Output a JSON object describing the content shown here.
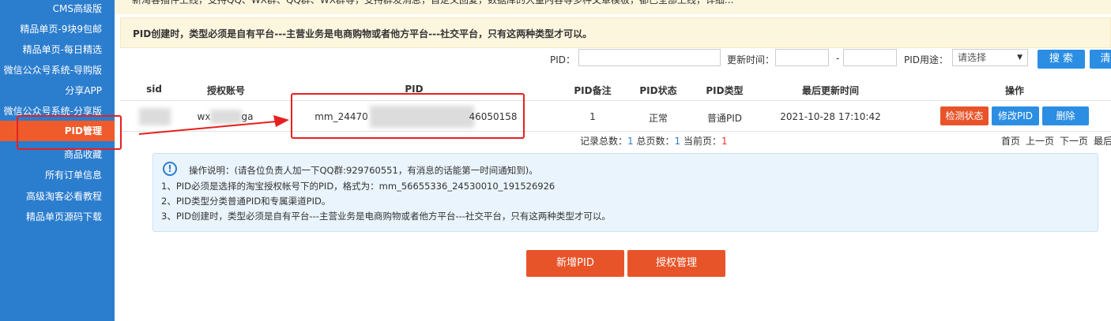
{
  "sidebar": {
    "items": [
      {
        "label": "CMS高级版"
      },
      {
        "label": "精品单页-9块9包邮"
      },
      {
        "label": "精品单页-每日精选"
      },
      {
        "label": "微信公众号系统-导购版"
      },
      {
        "label": "分享APP"
      },
      {
        "label": "微信公众号系统-分享版"
      },
      {
        "label": "PID管理"
      },
      {
        "label": "商品收藏"
      },
      {
        "label": "所有订单信息"
      },
      {
        "label": "高级淘客必看教程"
      },
      {
        "label": "精品单页源码下载"
      }
    ]
  },
  "notice_top": "新淘客插件上线，支持QQ、WX群、QQ群、WX群等，支持群发消息，自定义回复，数据库的大量内容等多种文章模板，都已全部上线，详细...",
  "notice": "PID创建时，类型必须是自有平台---主营业务是电商购物或者他方平台---社交平台，只有这两种类型才可以。",
  "search": {
    "pid_label": "PID：",
    "time_label": "更新时间：",
    "dash": "-",
    "use_label": "PID用途：",
    "use_value": "请选择",
    "search_btn": "搜 索",
    "clear_btn": "清"
  },
  "table": {
    "headers": [
      "sid",
      "授权账号",
      "PID",
      "PID备注",
      "PID状态",
      "PID类型",
      "最后更新时间",
      "操作"
    ],
    "row": {
      "account_prefix": "wx",
      "account_suffix": "ga",
      "pid_prefix": "mm_24470",
      "pid_suffix": "46050158",
      "note": "1",
      "status": "正常",
      "type": "普通PID",
      "updated": "2021-10-28 17:10:42",
      "btn_check": "检测状态",
      "btn_edit": "修改PID",
      "btn_delete": "删除"
    }
  },
  "pager": {
    "total_label": "记录总数：",
    "total": "1",
    "pages_label": " 总页数：",
    "pages": "1",
    "current_label": " 当前页：",
    "current": "1",
    "first": "首页",
    "prev": "上一页",
    "next": "下一页",
    "last": "最后"
  },
  "info": {
    "title": "操作说明：(请各位负责人加一下QQ群:929760551，有消息的话能第一时间通知到)。",
    "line1": "1、PID必须是选择的淘宝授权帐号下的PID，格式为：mm_56655336_24530010_191526926",
    "line2": "2、PID类型分类普通PID和专属渠道PID。",
    "line3": "3、PID创建时，类型必须是自有平台---主营业务是电商购物或者他方平台---社交平台，只有这两种类型才可以。"
  },
  "actions": {
    "add_pid": "新增PID",
    "auth_manage": "授权管理"
  },
  "colors": {
    "sidebar": "#2b7dce",
    "accent_orange": "#e8542a",
    "button_blue": "#2b8ee3",
    "annotation_red": "#e62020"
  }
}
